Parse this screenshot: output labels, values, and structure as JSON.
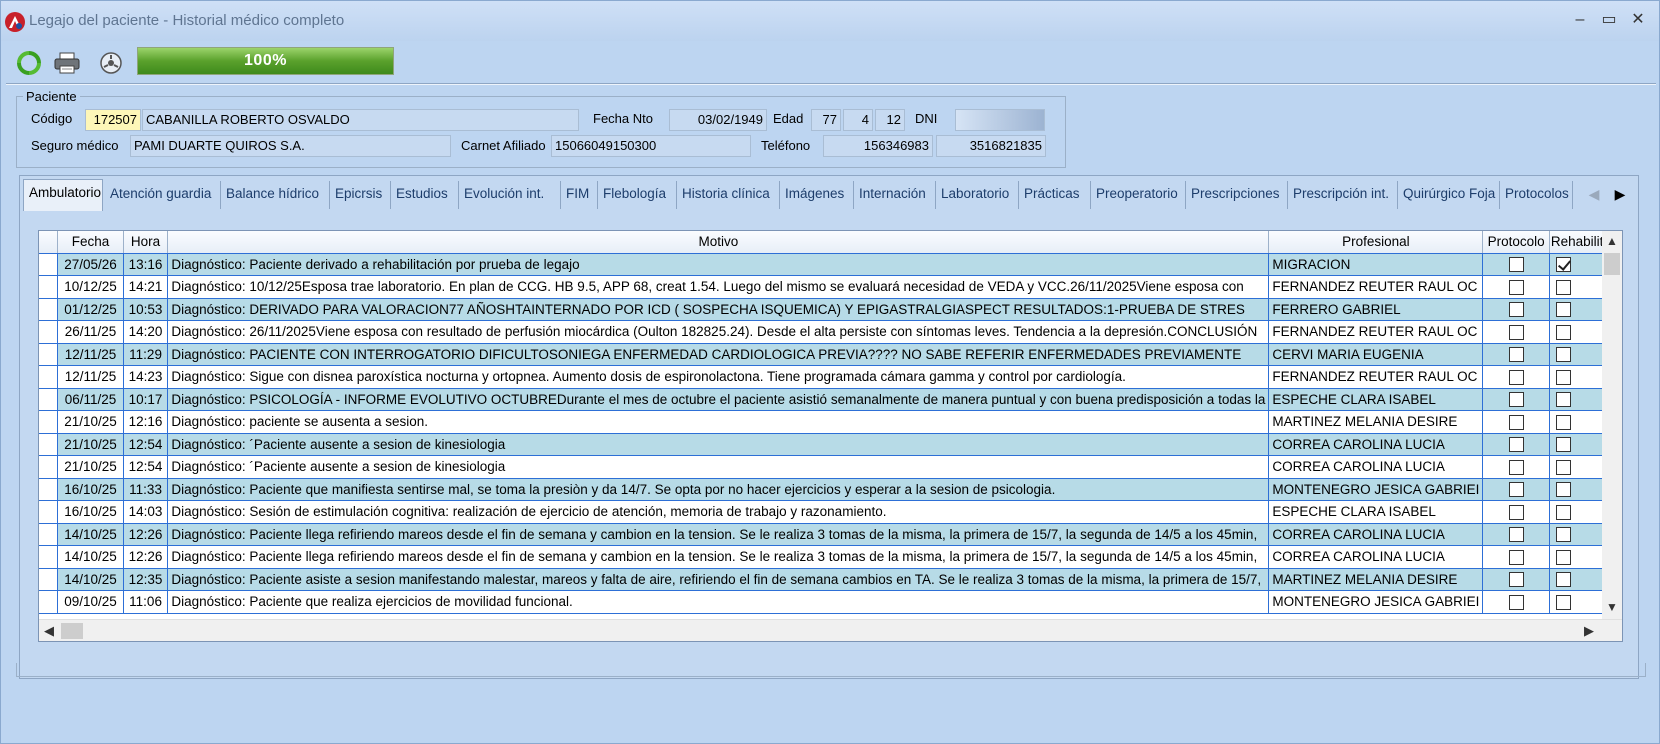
{
  "window": {
    "title": "Legajo del paciente - Historial médico completo"
  },
  "colors": {
    "accent": "#2d6fd6",
    "alt_row": "#b7dbe7",
    "highlight": "#fdf6b8",
    "progress": "#5aa12c"
  },
  "toolbar": {
    "icons": [
      "refresh-icon",
      "print-icon",
      "settings-icon"
    ],
    "progress_label": "100%",
    "progress_value": 100
  },
  "paciente": {
    "legend": "Paciente",
    "codigo_label": "Código",
    "codigo": "172507",
    "nombre": "CABANILLA ROBERTO OSVALDO",
    "fecha_nto_label": "Fecha Nto",
    "fecha_nto": "03/02/1949",
    "edad_label": "Edad",
    "edad_anios": "77",
    "edad_meses": "4",
    "edad_dias": "12",
    "dni_label": "DNI",
    "dni": "",
    "seguro_label": "Seguro médico",
    "seguro": "PAMI DUARTE QUIROS S.A.",
    "carnet_label": "Carnet Afiliado",
    "carnet": "15066049150300",
    "telefono_label": "Teléfono",
    "telefono1": "156346983",
    "telefono2": "3516821835"
  },
  "tabs": [
    "Ambulatorio",
    "Atención guardia",
    "Balance hídrico",
    "Epicrsis",
    "Estudios",
    "Evolución int.",
    "FIM",
    "Flebología",
    "Historia clínica",
    "Imágenes",
    "Internación",
    "Laboratorio",
    "Prácticas",
    "Preoperatorio",
    "Prescripciones",
    "Prescripción int.",
    "Quirúrgico Foja",
    "Protocolos"
  ],
  "grid": {
    "columns": [
      "Fecha",
      "Hora",
      "Motivo",
      "Profesional",
      "Protocolo",
      "Rehabilitac"
    ],
    "rows": [
      {
        "fecha": "27/05/26",
        "hora": "13:16",
        "motivo": "Diagnóstico: Paciente derivado a rehabilitación por prueba de legajo",
        "profesional": "MIGRACION",
        "protocolo": false,
        "rehab": true
      },
      {
        "fecha": "10/12/25",
        "hora": "14:21",
        "motivo": "Diagnóstico: 10/12/25Esposa trae laboratorio. En plan de  CCG. HB 9.5, APP 68, creat 1.54. Luego del mismo se evaluará necesidad de VEDA y VCC.26/11/2025Viene esposa con",
        "profesional": "FERNANDEZ REUTER RAUL OC",
        "protocolo": false,
        "rehab": false
      },
      {
        "fecha": "01/12/25",
        "hora": "10:53",
        "motivo": "Diagnóstico: DERIVADO PARA VALORACION77 AÑOSHTAINTERNADO POR ICD ( SOSPECHA ISQUEMICA) Y EPIGASTRALGIASPECT RESULTADOS:1-PRUEBA DE STRES",
        "profesional": "FERRERO GABRIEL",
        "protocolo": false,
        "rehab": false
      },
      {
        "fecha": "26/11/25",
        "hora": "14:20",
        "motivo": "Diagnóstico: 26/11/2025Viene esposa con resultado de perfusión miocárdica (Oulton 182825.24). Desde el alta persiste con síntomas leves. Tendencia a la depresión.CONCLUSIÓN",
        "profesional": "FERNANDEZ REUTER RAUL OC",
        "protocolo": false,
        "rehab": false
      },
      {
        "fecha": "12/11/25",
        "hora": "11:29",
        "motivo": "Diagnóstico: PACIENTE CON INTERROGATORIO DIFICULTOSONIEGA ENFERMEDAD  CARDIOLOGICA PREVIA???? NO  SABE REFERIR ENFERMEDADES  PREVIAMENTE",
        "profesional": "CERVI MARIA EUGENIA",
        "protocolo": false,
        "rehab": false
      },
      {
        "fecha": "12/11/25",
        "hora": "14:23",
        "motivo": "Diagnóstico: Sigue con disnea paroxística nocturna y ortopnea. Aumento dosis de espironolactona. Tiene programada cámara gamma y control por cardiología.",
        "profesional": "FERNANDEZ REUTER RAUL OC",
        "protocolo": false,
        "rehab": false
      },
      {
        "fecha": "06/11/25",
        "hora": "10:17",
        "motivo": "Diagnóstico: PSICOLOGÍA - INFORME EVOLUTIVO OCTUBREDurante el mes de octubre el paciente asistió semanalmente de manera puntual y con buena predisposición a todas la",
        "profesional": "ESPECHE CLARA ISABEL",
        "protocolo": false,
        "rehab": false
      },
      {
        "fecha": "21/10/25",
        "hora": "12:16",
        "motivo": "Diagnóstico: paciente se ausenta a sesion.",
        "profesional": "MARTINEZ MELANIA DESIRE",
        "protocolo": false,
        "rehab": false
      },
      {
        "fecha": "21/10/25",
        "hora": "12:54",
        "motivo": "Diagnóstico: ´Paciente ausente a sesion de kinesiologia",
        "profesional": "CORREA CAROLINA LUCIA",
        "protocolo": false,
        "rehab": false
      },
      {
        "fecha": "21/10/25",
        "hora": "12:54",
        "motivo": "Diagnóstico: ´Paciente ausente a sesion de kinesiologia",
        "profesional": "CORREA CAROLINA LUCIA",
        "protocolo": false,
        "rehab": false
      },
      {
        "fecha": "16/10/25",
        "hora": "11:33",
        "motivo": "Diagnóstico: Paciente que manifiesta sentirse mal, se toma la presiòn y da 14/7. Se opta por no hacer ejercicios y esperar a la sesion de psicologia.",
        "profesional": "MONTENEGRO JESICA GABRIEI",
        "protocolo": false,
        "rehab": false
      },
      {
        "fecha": "16/10/25",
        "hora": "14:03",
        "motivo": "Diagnóstico: Sesión de estimulación cognitiva: realización de ejercicio de atención, memoria de trabajo y razonamiento.",
        "profesional": "ESPECHE CLARA ISABEL",
        "protocolo": false,
        "rehab": false
      },
      {
        "fecha": "14/10/25",
        "hora": "12:26",
        "motivo": "Diagnóstico: Paciente llega refiriendo mareos desde el fin de semana y cambion en la tension. Se le realiza 3 tomas de la misma, la primera de 15/7, la segunda de 14/5  a los 45min,",
        "profesional": "CORREA CAROLINA LUCIA",
        "protocolo": false,
        "rehab": false
      },
      {
        "fecha": "14/10/25",
        "hora": "12:26",
        "motivo": "Diagnóstico: Paciente llega refiriendo mareos desde el fin de semana y cambion en la tension. Se le realiza 3 tomas de la misma, la primera de 15/7, la segunda de 14/5  a los 45min,",
        "profesional": "CORREA CAROLINA LUCIA",
        "protocolo": false,
        "rehab": false
      },
      {
        "fecha": "14/10/25",
        "hora": "12:35",
        "motivo": "Diagnóstico: Paciente asiste a sesion manifestando malestar, mareos y falta de aire, refiriendo  el fin de semana  cambios en TA. Se le realiza 3 tomas de la misma, la primera de 15/7,",
        "profesional": "MARTINEZ MELANIA DESIRE",
        "protocolo": false,
        "rehab": false
      },
      {
        "fecha": "09/10/25",
        "hora": "11:06",
        "motivo": "Diagnóstico: Paciente que realiza ejercicios de movilidad funcional.",
        "profesional": "MONTENEGRO JESICA GABRIEI",
        "protocolo": false,
        "rehab": false
      }
    ]
  }
}
